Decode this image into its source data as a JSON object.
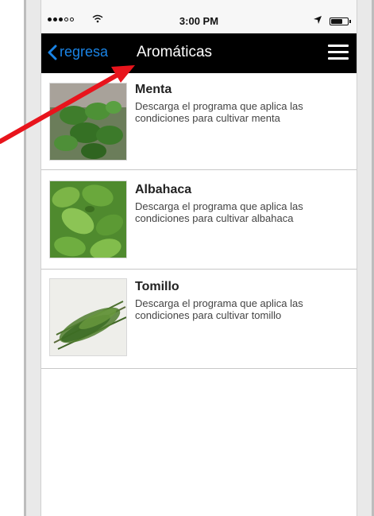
{
  "status_bar": {
    "time": "3:00 PM",
    "wifi_icon": "wifi-icon",
    "location_icon": "location-arrow-icon",
    "battery_icon": "battery-icon",
    "battery_level": 0.7
  },
  "nav_bar": {
    "back_label": "regresa",
    "title": "Aromáticas",
    "menu_icon": "hamburger-menu-icon",
    "accent_color": "#1a84e6",
    "background_color": "#000000"
  },
  "items": [
    {
      "title": "Menta",
      "description": "Descarga el programa que aplica las condiciones para cultivar menta",
      "image": "mint-plant-photo"
    },
    {
      "title": "Albahaca",
      "description": "Descarga el programa que aplica las condiciones para cultivar albahaca",
      "image": "basil-leaves-photo"
    },
    {
      "title": "Tomillo",
      "description": "Descarga el programa que aplica las condiciones para cultivar tomillo",
      "image": "thyme-bundle-photo"
    }
  ],
  "annotation": {
    "arrow_color": "#e8141c"
  }
}
